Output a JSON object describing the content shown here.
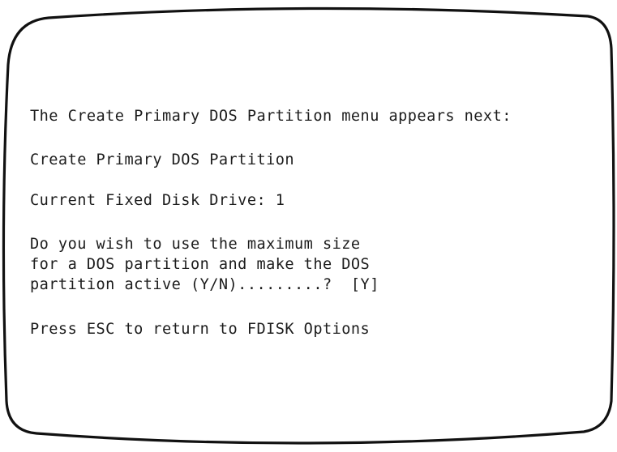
{
  "screen": {
    "intro": "The Create Primary DOS Partition menu appears next:",
    "menu_title": "Create Primary DOS Partition",
    "current_drive": "Current Fixed Disk Drive: 1",
    "question_line_1": "Do you wish to use the maximum size",
    "question_line_2": "for a DOS partition and make the DOS",
    "question_line_3": "partition active (Y/N).........?  [Y]",
    "escape_hint": "Press ESC to return to FDISK Options"
  }
}
